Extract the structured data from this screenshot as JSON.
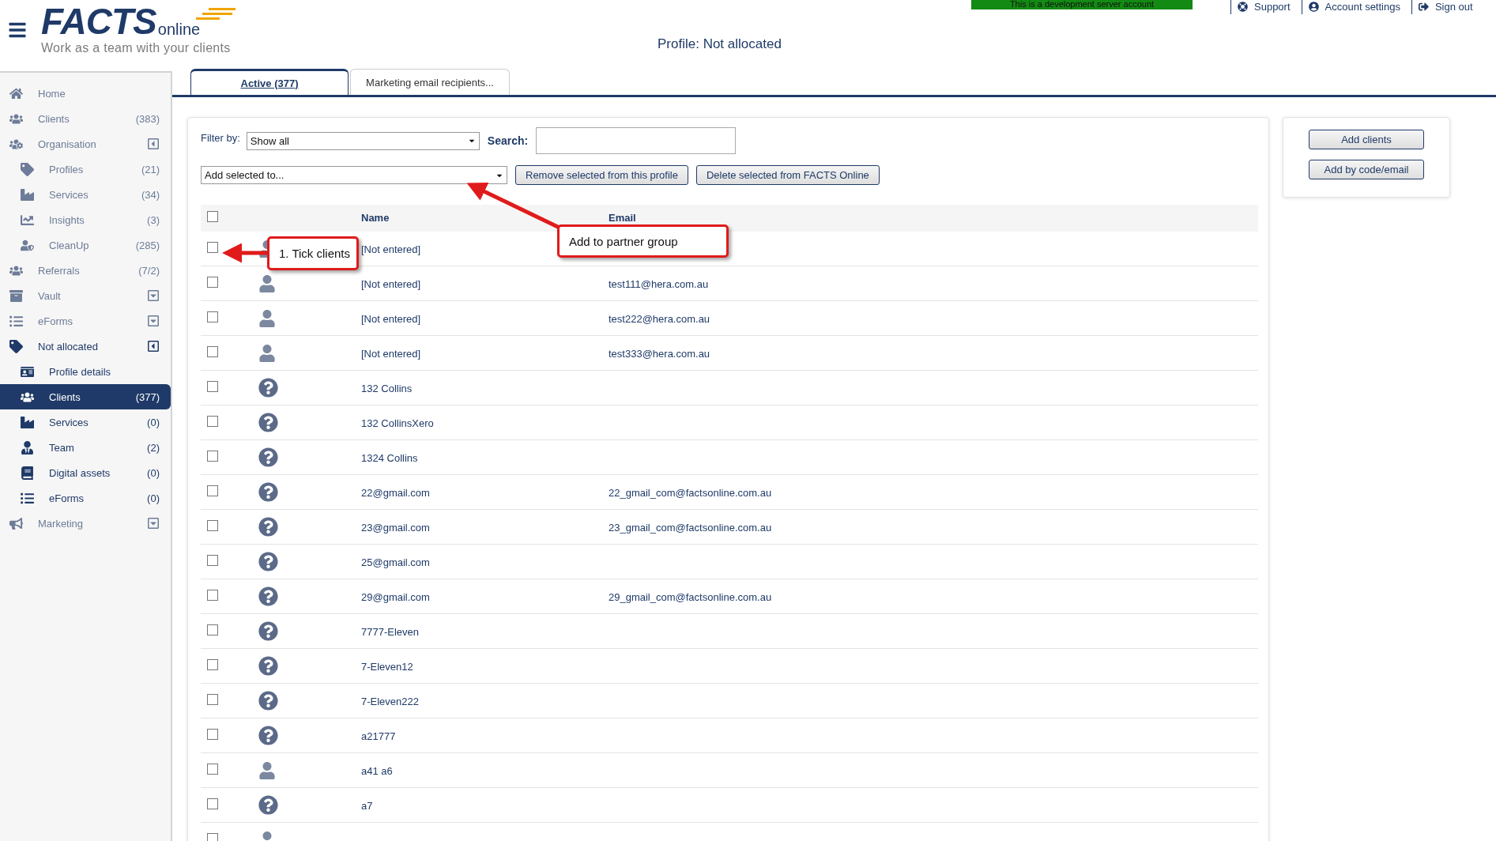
{
  "header": {
    "logo": {
      "wordmark": "FACTS",
      "suffix": "online",
      "tagline": "Work as a team with your clients"
    },
    "dev_banner": "This is a development server account",
    "title": "Profile: Not allocated",
    "links": [
      {
        "label": "Support"
      },
      {
        "label": "Account settings"
      },
      {
        "label": "Sign out"
      }
    ]
  },
  "sidebar": {
    "items": [
      {
        "label": "Home",
        "current": false,
        "selected": false
      },
      {
        "label": "Clients",
        "count": "(383)",
        "current": false,
        "selected": false
      },
      {
        "label": "Organisation",
        "expanded": true,
        "current": false,
        "selected": false,
        "children": [
          {
            "label": "Profiles",
            "count": "(21)",
            "selected": false
          },
          {
            "label": "Services",
            "count": "(34)",
            "selected": false
          },
          {
            "label": "Insights",
            "count": "(3)",
            "selected": false
          },
          {
            "label": "CleanUp",
            "count": "(285)",
            "selected": false
          }
        ]
      },
      {
        "label": "Referrals",
        "count": "(7/2)",
        "current": false,
        "selected": false
      },
      {
        "label": "Vault",
        "expanded": false,
        "current": false,
        "selected": false
      },
      {
        "label": "eForms",
        "expanded": false,
        "current": false,
        "selected": false
      },
      {
        "label": "Not allocated",
        "expanded": true,
        "current": true,
        "selected": false,
        "children": [
          {
            "label": "Profile details",
            "selected": false
          },
          {
            "label": "Clients",
            "count": "(377)",
            "selected": true
          },
          {
            "label": "Services",
            "count": "(0)",
            "selected": false
          },
          {
            "label": "Team",
            "count": "(2)",
            "selected": false
          },
          {
            "label": "Digital assets",
            "count": "(0)",
            "selected": false
          },
          {
            "label": "eForms",
            "count": "(0)",
            "selected": false
          }
        ]
      },
      {
        "label": "Marketing",
        "expanded": false,
        "current": false,
        "selected": false
      }
    ]
  },
  "tabs": [
    {
      "label": "Active (377)",
      "selected": true
    },
    {
      "label": "Marketing email recipients...",
      "selected": false
    }
  ],
  "filter": {
    "label": "Filter by:",
    "value": "Show all",
    "search_label": "Search:"
  },
  "actions": {
    "add_selected": "Add selected to...",
    "buttons": [
      "Remove selected from this profile",
      "Delete selected from FACTS Online"
    ]
  },
  "side_buttons": [
    "Add clients",
    "Add by code/email"
  ],
  "table": {
    "columns": [
      "Name",
      "Email"
    ],
    "select_all_checked": false,
    "rows": [
      {
        "kind": "person",
        "name": "[Not entered]",
        "checked": false
      },
      {
        "kind": "person",
        "name": "[Not entered]",
        "email": "test111@hera.com.au",
        "checked": false
      },
      {
        "kind": "person",
        "name": "[Not entered]",
        "email": "test222@hera.com.au",
        "checked": false
      },
      {
        "kind": "person",
        "name": "[Not entered]",
        "email": "test333@hera.com.au",
        "checked": false
      },
      {
        "kind": "unknown",
        "name": "132 Collins",
        "checked": false
      },
      {
        "kind": "unknown",
        "name": "132 CollinsXero",
        "checked": false
      },
      {
        "kind": "unknown",
        "name": "1324 Collins",
        "checked": false
      },
      {
        "kind": "unknown",
        "name": "22@gmail.com",
        "email": "22_gmail_com@factsonline.com.au",
        "checked": false
      },
      {
        "kind": "unknown",
        "name": "23@gmail.com",
        "email": "23_gmail_com@factsonline.com.au",
        "checked": false
      },
      {
        "kind": "unknown",
        "name": "25@gmail.com",
        "checked": false
      },
      {
        "kind": "unknown",
        "name": "29@gmail.com",
        "email": "29_gmail_com@factsonline.com.au",
        "checked": false
      },
      {
        "kind": "unknown",
        "name": "7777-Eleven",
        "checked": false
      },
      {
        "kind": "unknown",
        "name": "7-Eleven12",
        "checked": false
      },
      {
        "kind": "unknown",
        "name": "7-Eleven222",
        "checked": false
      },
      {
        "kind": "unknown",
        "name": "a21777",
        "checked": false
      },
      {
        "kind": "person",
        "name": "a41 a6",
        "checked": false
      },
      {
        "kind": "unknown",
        "name": "a7",
        "checked": false
      },
      {
        "kind": "person",
        "checked": false
      }
    ]
  },
  "callouts": [
    {
      "text": "1. Tick clients"
    },
    {
      "text": "Add to partner group"
    }
  ]
}
